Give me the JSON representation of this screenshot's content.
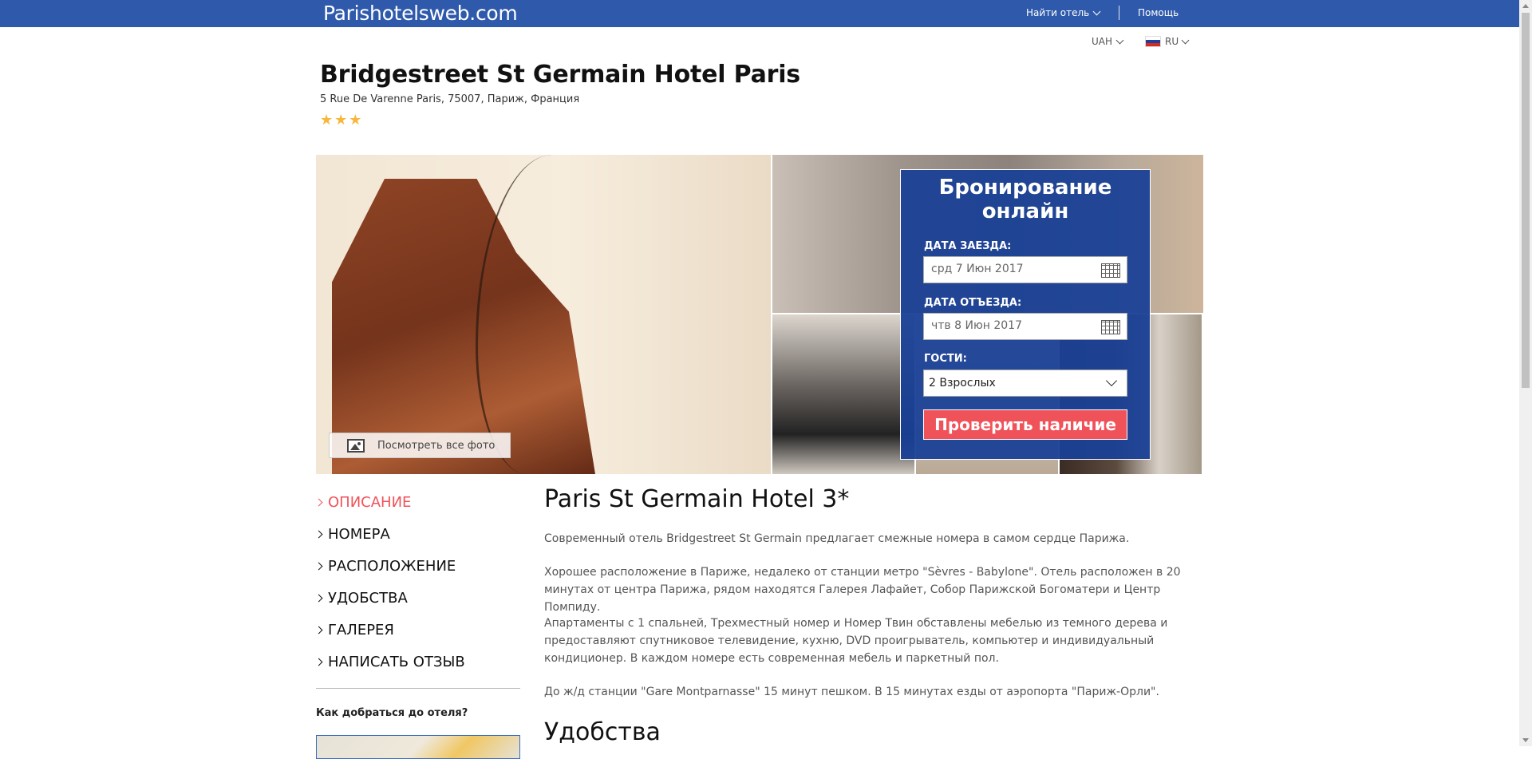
{
  "header": {
    "logo": "Parishotelsweb.com",
    "find_hotel": "Найти отель",
    "help": "Помощь"
  },
  "locale": {
    "currency": "UAH",
    "language": "RU"
  },
  "hotel": {
    "name": "Bridgestreet St Germain Hotel Paris",
    "address": "5 Rue De Varenne Paris, 75007, Париж, Франция",
    "stars": "★★★"
  },
  "gallery": {
    "see_all_photos": "Посмотреть все фото"
  },
  "booking": {
    "title": "Бронирование онлайн",
    "checkin_label": "ДАТА ЗАЕЗДА:",
    "checkin_value": "срд 7 Июн 2017",
    "checkout_label": "ДАТА ОТЪЕЗДА:",
    "checkout_value": "чтв 8 Июн 2017",
    "guests_label": "ГОСТИ:",
    "guests_value": "2 Взрослых",
    "submit_label": "Проверить наличие"
  },
  "sidebar": {
    "items": [
      {
        "label": "ОПИСАНИЕ"
      },
      {
        "label": "НОМЕРА"
      },
      {
        "label": "РАСПОЛОЖЕНИЕ"
      },
      {
        "label": "УДОБСТВА"
      },
      {
        "label": "ГАЛЕРЕЯ"
      },
      {
        "label": "НАПИСАТЬ ОТЗЫВ"
      }
    ],
    "how_to_get": "Как добраться до отеля?"
  },
  "content": {
    "title": "Paris St Germain Hotel 3*",
    "paragraphs": [
      "Современный отель Bridgestreet St Germain предлагает смежные номера в самом сердце Парижа.",
      "Хорошее расположение в Париже, недалеко от станции метро \"Sèvres - Babylone\". Отель расположен в 20 минутах от центра Парижа, рядом находятся Галерея Лафайет, Собор Парижской Богоматери и Центр Помпиду.",
      "Апартаменты с 1 спальней, Трехместный номер и Номер Твин обставлены мебелью из темного дерева и предоставляют спутниковое телевидение, кухню, DVD проигрыватель, компьютер и индивидуальный кондиционер. В каждом номере есть современная мебель и паркетный пол.",
      "До ж/д станции \"Gare Montparnasse\" 15 минут пешком. В 15 минутах езды от аэропорта \"Париж-Орли\"."
    ],
    "amenities_heading": "Удобства"
  },
  "colors": {
    "topbar": "#2f5aab",
    "booking_bg": "#1a4096",
    "accent_red": "#f0525a",
    "star": "#f6b73c"
  }
}
